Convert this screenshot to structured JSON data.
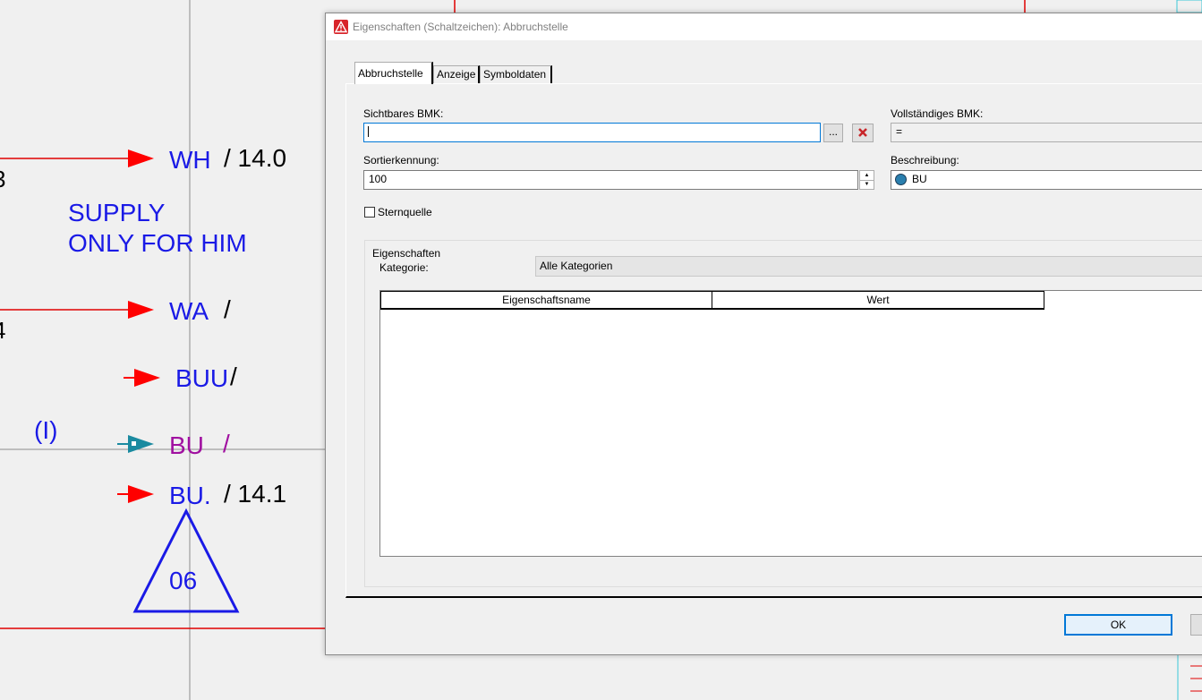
{
  "schematic": {
    "labels": {
      "wh": "WH",
      "wh_ref": "/ 14.0",
      "left_frag_1": "3",
      "supply_line1": "SUPPLY",
      "supply_line2": "ONLY FOR HIM",
      "wa": "WA",
      "wa_ref": "/",
      "left_frag_2": "4",
      "buu": "BUU",
      "buu_ref": "/",
      "roman_i": "(I)",
      "bu": "BU",
      "bu_ref": "/",
      "bu_dot": "BU.",
      "bu_dot_ref": "/ 14.1",
      "triangle_num": "06"
    },
    "colors": {
      "wire": "#e00000",
      "text_blue": "#1a1ae6",
      "text_purple": "#a010a0",
      "teal": "#1a8aa0"
    }
  },
  "dialog": {
    "title": "Eigenschaften (Schaltzeichen): Abbruchstelle",
    "tabs": [
      {
        "label": "Abbruchstelle",
        "active": true
      },
      {
        "label": "Anzeige",
        "active": false
      },
      {
        "label": "Symboldaten",
        "active": false
      }
    ],
    "fields": {
      "sichtbares_bmk_label": "Sichtbares BMK:",
      "sichtbares_bmk_value": "",
      "browse_label": "...",
      "vollstaendiges_bmk_label": "Vollständiges BMK:",
      "vollstaendiges_bmk_value": "=",
      "sortierkennung_label": "Sortierkennung:",
      "sortierkennung_value": "100",
      "beschreibung_label": "Beschreibung:",
      "beschreibung_value": "BU",
      "sternquelle_label": "Sternquelle",
      "sternquelle_checked": false
    },
    "eigenschaften": {
      "legend": "Eigenschaften",
      "kategorie_label": "Kategorie:",
      "kategorie_value": "Alle Kategorien",
      "columns": [
        "Eigenschaftsname",
        "Wert"
      ],
      "rows": []
    },
    "buttons": {
      "ok_label": "OK"
    }
  }
}
